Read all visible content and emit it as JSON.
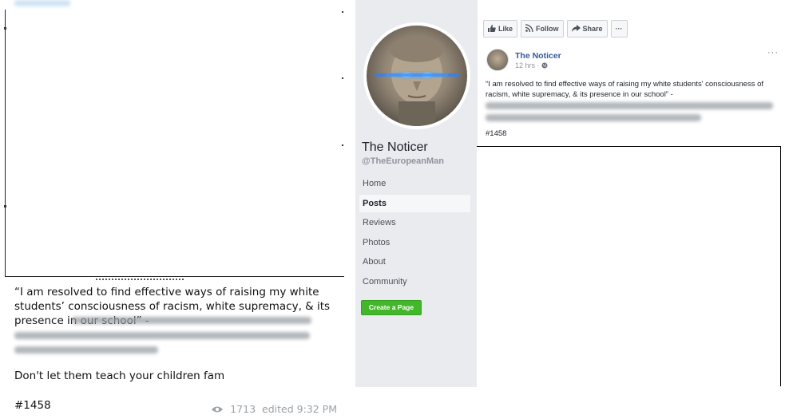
{
  "left_post": {
    "quote": "“I am resolved to find effective ways of raising my white students’ consciousness of racism, white supremacy, & its presence in our school” -",
    "note": "Don't let them teach your children fam",
    "hashtag": "#1458",
    "views": "1713",
    "edited": "edited 9:32 PM"
  },
  "facebook": {
    "page_name": "The Noticer",
    "handle": "@TheEuropeanMan",
    "nav": [
      "Home",
      "Posts",
      "Reviews",
      "Photos",
      "About",
      "Community"
    ],
    "active_nav": "Posts",
    "create_page_label": "Create a Page",
    "actions": {
      "like": "Like",
      "follow": "Follow",
      "share": "Share",
      "more": "···"
    },
    "post": {
      "author": "The Noticer",
      "time": "12 hrs · ",
      "more": "···",
      "text": "“I am resolved to find effective ways of raising my white students' consciousness of racism, white supremacy, & its presence in our school” -",
      "hashtag": "#1458"
    }
  },
  "colors": {
    "fb_blue": "#365899",
    "fb_green": "#42b72a",
    "fb_gray_bg": "#e9ebee"
  }
}
